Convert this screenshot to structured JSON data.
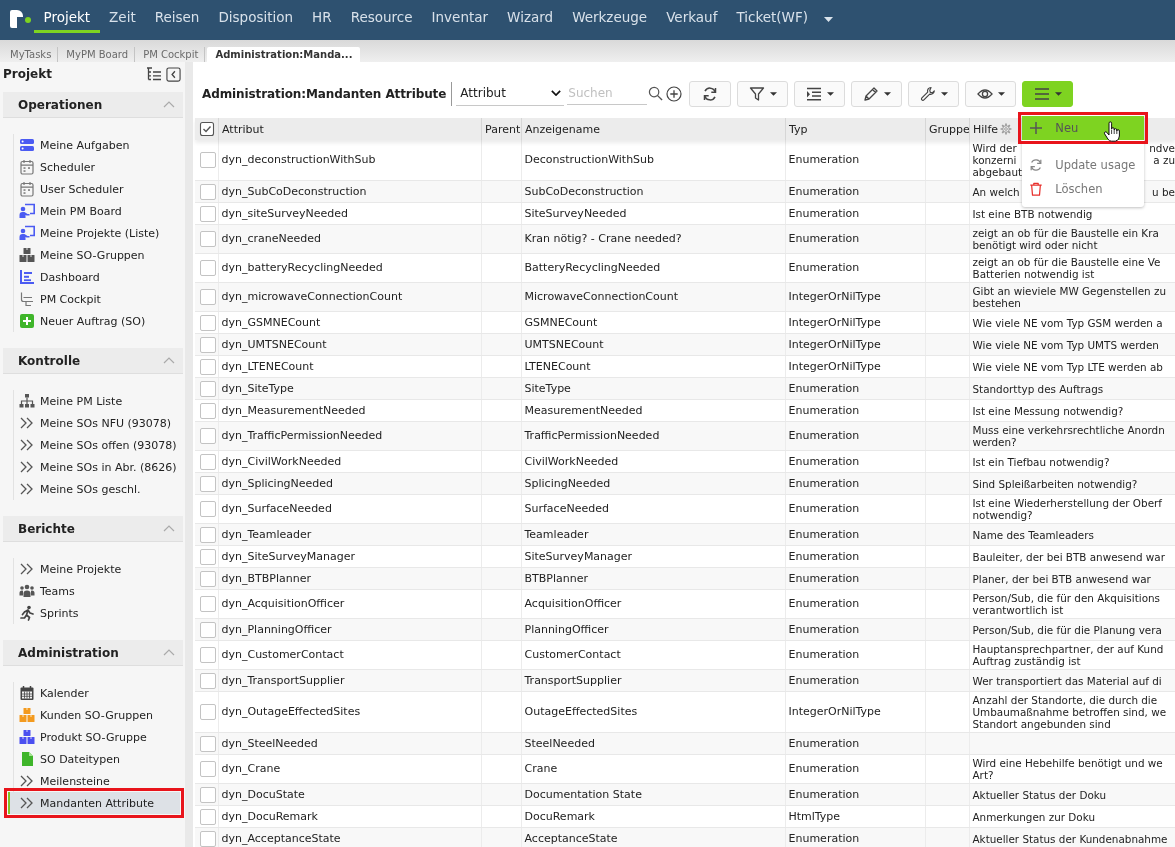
{
  "top_nav": {
    "items": [
      {
        "label": "Projekt",
        "selected": true
      },
      {
        "label": "Zeit",
        "selected": false
      },
      {
        "label": "Reisen",
        "selected": false
      },
      {
        "label": "Disposition",
        "selected": false
      },
      {
        "label": "HR",
        "selected": false
      },
      {
        "label": "Resource",
        "selected": false
      },
      {
        "label": "Inventar",
        "selected": false
      },
      {
        "label": "Wizard",
        "selected": false
      },
      {
        "label": "Werkzeuge",
        "selected": false
      },
      {
        "label": "Verkauf",
        "selected": false
      },
      {
        "label": "Ticket(WF)",
        "selected": false
      }
    ]
  },
  "tabs": [
    {
      "label": "MyTasks",
      "selected": false
    },
    {
      "label": "MyPM Board",
      "selected": false
    },
    {
      "label": "PM Cockpit",
      "selected": false
    },
    {
      "label": "Administration:Manda...",
      "selected": true
    }
  ],
  "sidebar": {
    "title": "Projekt",
    "sections": [
      {
        "title": "Operationen",
        "expanded": true,
        "items": [
          {
            "label": "Meine Aufgaben",
            "selected": false,
            "annotated": false
          },
          {
            "label": "Scheduler",
            "selected": false,
            "annotated": false
          },
          {
            "label": "User Scheduler",
            "selected": false,
            "annotated": false
          },
          {
            "label": "Mein PM Board",
            "selected": false,
            "annotated": false
          },
          {
            "label": "Meine Projekte (Liste)",
            "selected": false,
            "annotated": false
          },
          {
            "label": "Meine SO-Gruppen",
            "selected": false,
            "annotated": false
          },
          {
            "label": "Dashboard",
            "selected": false,
            "annotated": false
          },
          {
            "label": "PM Cockpit",
            "selected": false,
            "annotated": false
          },
          {
            "label": "Neuer Auftrag (SO)",
            "selected": false,
            "annotated": false
          }
        ]
      },
      {
        "title": "Kontrolle",
        "expanded": true,
        "items": [
          {
            "label": "Meine PM Liste",
            "selected": false,
            "annotated": false
          },
          {
            "label": "Meine SOs NFU (93078)",
            "selected": false,
            "annotated": false
          },
          {
            "label": "Meine SOs offen (93078)",
            "selected": false,
            "annotated": false
          },
          {
            "label": "Meine SOs in Abr. (8626)",
            "selected": false,
            "annotated": false
          },
          {
            "label": "Meine SOs geschl.",
            "selected": false,
            "annotated": false
          }
        ]
      },
      {
        "title": "Berichte",
        "expanded": true,
        "items": [
          {
            "label": "Meine Projekte",
            "selected": false,
            "annotated": false
          },
          {
            "label": "Teams",
            "selected": false,
            "annotated": false
          },
          {
            "label": "Sprints",
            "selected": false,
            "annotated": false
          }
        ]
      },
      {
        "title": "Administration",
        "expanded": true,
        "items": [
          {
            "label": "Kalender",
            "selected": false,
            "annotated": false
          },
          {
            "label": "Kunden SO-Gruppen",
            "selected": false,
            "annotated": false
          },
          {
            "label": "Produkt SO-Gruppe",
            "selected": false,
            "annotated": false
          },
          {
            "label": "SO Dateitypen",
            "selected": false,
            "annotated": false
          },
          {
            "label": "Meilensteine",
            "selected": false,
            "annotated": false
          },
          {
            "label": "Mandanten Attribute",
            "selected": true,
            "annotated": true
          }
        ]
      }
    ]
  },
  "panel": {
    "title": "Administration:Mandanten Attribute",
    "filter_select": {
      "value": "Attribut"
    },
    "search": {
      "placeholder": "Suchen"
    },
    "actions_menu": {
      "open": true,
      "items": [
        {
          "label": "Neu",
          "selected": true,
          "annotated": true
        },
        {
          "label": "Update usage",
          "selected": false,
          "annotated": false
        },
        {
          "label": "Löschen",
          "selected": false,
          "annotated": false
        }
      ]
    }
  },
  "table": {
    "columns": [
      "Attribut",
      "Parent",
      "Anzeigename",
      "Typ",
      "Gruppe",
      "Hilfe"
    ],
    "rows": [
      {
        "checked": false,
        "attribute": "dyn_deconstructionWithSub",
        "display_name": "DeconstructionWithSub",
        "type": "Enumeration",
        "help": [
          [
            "Wird der",
            "ndve"
          ],
          [
            "konzerni",
            "a zu"
          ],
          [
            "abgebaut"
          ]
        ]
      },
      {
        "checked": false,
        "attribute": "dyn_SubCoDeconstruction",
        "display_name": "SubCoDeconstruction",
        "type": "Enumeration",
        "help": [
          [
            "An welch",
            "u be"
          ]
        ]
      },
      {
        "checked": false,
        "attribute": "dyn_siteSurveyNeeded",
        "display_name": "SiteSurveyNeeded",
        "type": "Enumeration",
        "help": [
          [
            "Ist eine BTB notwendig"
          ]
        ]
      },
      {
        "checked": false,
        "attribute": "dyn_craneNeeded",
        "display_name": "Kran nötig? - Crane needed?",
        "type": "Enumeration",
        "help": [
          [
            "zeigt an ob für die Baustelle ein Kra"
          ],
          [
            "benötigt wird oder nicht"
          ]
        ]
      },
      {
        "checked": false,
        "attribute": "dyn_batteryRecyclingNeeded",
        "display_name": "BatteryRecyclingNeeded",
        "type": "Enumeration",
        "help": [
          [
            "zeigt an ob für die Baustelle eine Ve"
          ],
          [
            "Batterien notwendig ist"
          ]
        ]
      },
      {
        "checked": false,
        "attribute": "dyn_microwaveConnectionCount",
        "display_name": "MicrowaveConnectionCount",
        "type": "IntegerOrNilType",
        "help": [
          [
            "Gibt an wieviele MW Gegenstellen zu"
          ],
          [
            "bestehen"
          ]
        ]
      },
      {
        "checked": false,
        "attribute": "dyn_GSMNECount",
        "display_name": "GSMNECount",
        "type": "IntegerOrNilType",
        "help": [
          [
            "Wie viele NE vom Typ GSM werden a"
          ]
        ]
      },
      {
        "checked": false,
        "attribute": "dyn_UMTSNECount",
        "display_name": "UMTSNECount",
        "type": "IntegerOrNilType",
        "help": [
          [
            "Wie viele NE vom Typ UMTS werden"
          ]
        ]
      },
      {
        "checked": false,
        "attribute": "dyn_LTENECount",
        "display_name": "LTENECount",
        "type": "IntegerOrNilType",
        "help": [
          [
            "Wie viele NE vom Typ LTE werden ab"
          ]
        ]
      },
      {
        "checked": false,
        "attribute": "dyn_SiteType",
        "display_name": "SiteType",
        "type": "Enumeration",
        "help": [
          [
            "Standorttyp des Auftrags"
          ]
        ]
      },
      {
        "checked": false,
        "attribute": "dyn_MeasurementNeeded",
        "display_name": "MeasurementNeeded",
        "type": "Enumeration",
        "help": [
          [
            "Ist eine Messung notwendig?"
          ]
        ]
      },
      {
        "checked": false,
        "attribute": "dyn_TrafficPermissionNeeded",
        "display_name": "TrafficPermissionNeeded",
        "type": "Enumeration",
        "help": [
          [
            "Muss eine verkehrsrechtliche Anordn"
          ],
          [
            "werden?"
          ]
        ]
      },
      {
        "checked": false,
        "attribute": "dyn_CivilWorkNeeded",
        "display_name": "CivilWorkNeeded",
        "type": "Enumeration",
        "help": [
          [
            "Ist ein Tiefbau notwendig?"
          ]
        ]
      },
      {
        "checked": false,
        "attribute": "dyn_SplicingNeeded",
        "display_name": "SplicingNeeded",
        "type": "Enumeration",
        "help": [
          [
            "Sind Spleißarbeiten notwendig?"
          ]
        ]
      },
      {
        "checked": false,
        "attribute": "dyn_SurfaceNeeded",
        "display_name": "SurfaceNeeded",
        "type": "Enumeration",
        "help": [
          [
            "Ist eine Wiederherstellung der Oberf"
          ],
          [
            "notwendig?"
          ]
        ]
      },
      {
        "checked": false,
        "attribute": "dyn_Teamleader",
        "display_name": "Teamleader",
        "type": "Enumeration",
        "help": [
          [
            "Name des Teamleaders"
          ]
        ]
      },
      {
        "checked": false,
        "attribute": "dyn_SiteSurveyManager",
        "display_name": "SiteSurveyManager",
        "type": "Enumeration",
        "help": [
          [
            "Bauleiter, der bei BTB anwesend war"
          ]
        ]
      },
      {
        "checked": false,
        "attribute": "dyn_BTBPlanner",
        "display_name": "BTBPlanner",
        "type": "Enumeration",
        "help": [
          [
            "Planer, der bei BTB anwesend war"
          ]
        ]
      },
      {
        "checked": false,
        "attribute": "dyn_AcquisitionOfficer",
        "display_name": "AcquisitionOfficer",
        "type": "Enumeration",
        "help": [
          [
            "Person/Sub, die für den Akquisitions"
          ],
          [
            "verantwortlich ist"
          ]
        ]
      },
      {
        "checked": false,
        "attribute": "dyn_PlanningOfficer",
        "display_name": "PlanningOfficer",
        "type": "Enumeration",
        "help": [
          [
            "Person/Sub, die für die Planung vera"
          ]
        ]
      },
      {
        "checked": false,
        "attribute": "dyn_CustomerContact",
        "display_name": "CustomerContact",
        "type": "Enumeration",
        "help": [
          [
            "Hauptansprechpartner, der auf Kund"
          ],
          [
            "Auftrag zuständig ist"
          ]
        ]
      },
      {
        "checked": false,
        "attribute": "dyn_TransportSupplier",
        "display_name": "TransportSupplier",
        "type": "Enumeration",
        "help": [
          [
            "Wer transportiert das Material auf di"
          ]
        ]
      },
      {
        "checked": false,
        "attribute": "dyn_OutageEffectedSites",
        "display_name": "OutageEffectedSites",
        "type": "IntegerOrNilType",
        "help": [
          [
            "Anzahl der Standorte, die durch die"
          ],
          [
            "Umbaumaßnahme betroffen sind, we"
          ],
          [
            "Standort angebunden sind"
          ]
        ]
      },
      {
        "checked": false,
        "attribute": "dyn_SteelNeeded",
        "display_name": "SteelNeeded",
        "type": "Enumeration"
      },
      {
        "checked": false,
        "attribute": "dyn_Crane",
        "display_name": "Crane",
        "type": "Enumeration",
        "help": [
          [
            "Wird eine Hebehilfe benötigt und we"
          ],
          [
            "Art?"
          ]
        ]
      },
      {
        "checked": false,
        "attribute": "dyn_DocuState",
        "display_name": "Documentation State",
        "type": "Enumeration",
        "help": [
          [
            "Aktueller Status der Doku"
          ]
        ]
      },
      {
        "checked": false,
        "attribute": "dyn_DocuRemark",
        "display_name": "DocuRemark",
        "type": "HtmlType",
        "help": [
          [
            "Anmerkungen zur Doku"
          ]
        ]
      },
      {
        "checked": false,
        "attribute": "dyn_AcceptanceState",
        "display_name": "AcceptanceState",
        "type": "Enumeration",
        "help": [
          [
            "Aktueller Status der Kundenabnahme"
          ]
        ]
      }
    ]
  }
}
